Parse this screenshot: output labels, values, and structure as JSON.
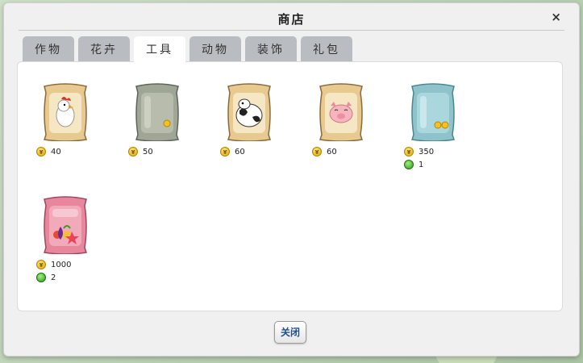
{
  "dialog": {
    "title": "商店",
    "close_icon": "×",
    "close_button_label": "关闭"
  },
  "tabs": [
    {
      "label": "作物",
      "active": false
    },
    {
      "label": "花卉",
      "active": false
    },
    {
      "label": "工具",
      "active": true
    },
    {
      "label": "动物",
      "active": false
    },
    {
      "label": "装饰",
      "active": false
    },
    {
      "label": "礼包",
      "active": false
    }
  ],
  "items": [
    {
      "icon": "chicken-feed-bag-icon",
      "coin_price": "40",
      "gem_price": null
    },
    {
      "icon": "gray-fertilizer-bag-icon",
      "coin_price": "50",
      "gem_price": null
    },
    {
      "icon": "cow-feed-bag-icon",
      "coin_price": "60",
      "gem_price": null
    },
    {
      "icon": "pig-feed-bag-icon",
      "coin_price": "60",
      "gem_price": null
    },
    {
      "icon": "blue-fertilizer-bag-icon",
      "coin_price": "350",
      "gem_price": "1"
    },
    {
      "icon": "pink-fruit-bag-icon",
      "coin_price": "1000",
      "gem_price": "2"
    }
  ],
  "colors": {
    "tab_inactive": "#b9bdc1",
    "tab_active": "#ffffff",
    "button_text": "#1d4f8f"
  }
}
